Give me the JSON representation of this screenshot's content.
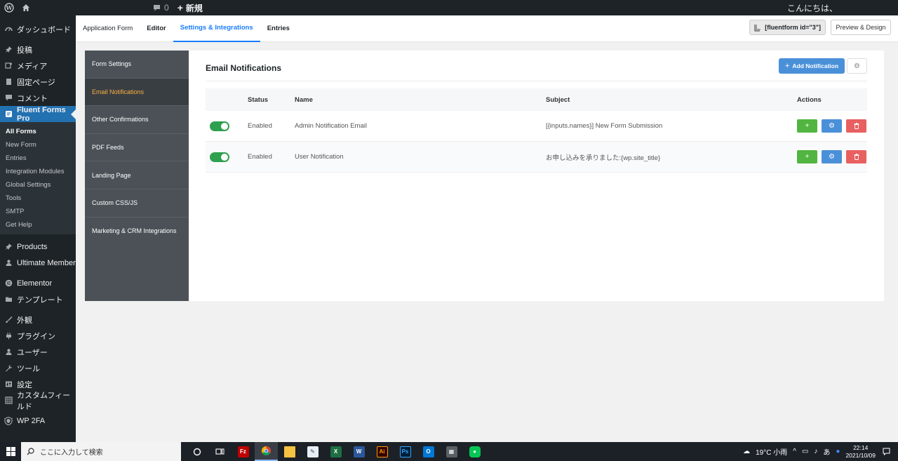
{
  "adminbar": {
    "comments_count": "0",
    "new_label": "新規",
    "greeting": "こんにちは、"
  },
  "sidebar": {
    "items_top": [
      {
        "icon": "dashboard-icon",
        "label": "ダッシュボード"
      }
    ],
    "items_content": [
      {
        "icon": "pin-icon",
        "label": "投稿"
      },
      {
        "icon": "media-icon",
        "label": "メディア"
      },
      {
        "icon": "page-icon",
        "label": "固定ページ"
      },
      {
        "icon": "comment-icon",
        "label": "コメント"
      }
    ],
    "active_item": {
      "icon": "fluent-forms-icon",
      "label": "Fluent Forms Pro"
    },
    "submenu": [
      "All Forms",
      "New Form",
      "Entries",
      "Integration Modules",
      "Global Settings",
      "Tools",
      "SMTP",
      "Get Help"
    ],
    "items_plugins": [
      {
        "icon": "pin-icon",
        "label": "Products"
      },
      {
        "icon": "user-icon",
        "label": "Ultimate Member"
      }
    ],
    "items_builder": [
      {
        "icon": "elementor-icon",
        "label": "Elementor"
      },
      {
        "icon": "folder-icon",
        "label": "テンプレート"
      }
    ],
    "items_admin": [
      {
        "icon": "brush-icon",
        "label": "外観"
      },
      {
        "icon": "plugin-icon",
        "label": "プラグイン"
      },
      {
        "icon": "user-icon",
        "label": "ユーザー"
      },
      {
        "icon": "wrench-icon",
        "label": "ツール"
      },
      {
        "icon": "settings-icon",
        "label": "設定"
      },
      {
        "icon": "grid-icon",
        "label": "カスタムフィールド"
      }
    ],
    "items_bottom": [
      {
        "icon": "shield-icon",
        "label": "WP 2FA"
      }
    ]
  },
  "topnav": {
    "tabs": [
      "Application Form",
      "Editor",
      "Settings & Integrations",
      "Entries"
    ],
    "shortcode": "[fluentform id=\"3\"]",
    "preview_label": "Preview & Design"
  },
  "settings_nav": [
    "Form Settings",
    "Email Notifications",
    "Other Confirmations",
    "PDF Feeds",
    "Landing Page",
    "Custom CSS/JS",
    "Marketing & CRM Integrations"
  ],
  "panel": {
    "title": "Email Notifications",
    "add_label": "Add Notification",
    "columns": {
      "status": "Status",
      "name": "Name",
      "subject": "Subject",
      "actions": "Actions"
    },
    "rows": [
      {
        "status": "Enabled",
        "name": "Admin Notification Email",
        "subject": "[{inputs.names}] New Form Submission",
        "enabled": true
      },
      {
        "status": "Enabled",
        "name": "User Notification",
        "subject": "お申し込みを承りました:{wp.site_title}",
        "enabled": true
      }
    ]
  },
  "taskbar": {
    "search_placeholder": "ここに入力して検索",
    "weather": "19°C 小雨",
    "ime": "あ",
    "time": "22:14",
    "date": "2021/10/09"
  },
  "colors": {
    "admin_bg": "#1d2327",
    "accent": "#2271b1",
    "tab_active": "#1a7efb",
    "settings_active_text": "#fbb040",
    "toggle_on": "#2ea04f"
  }
}
